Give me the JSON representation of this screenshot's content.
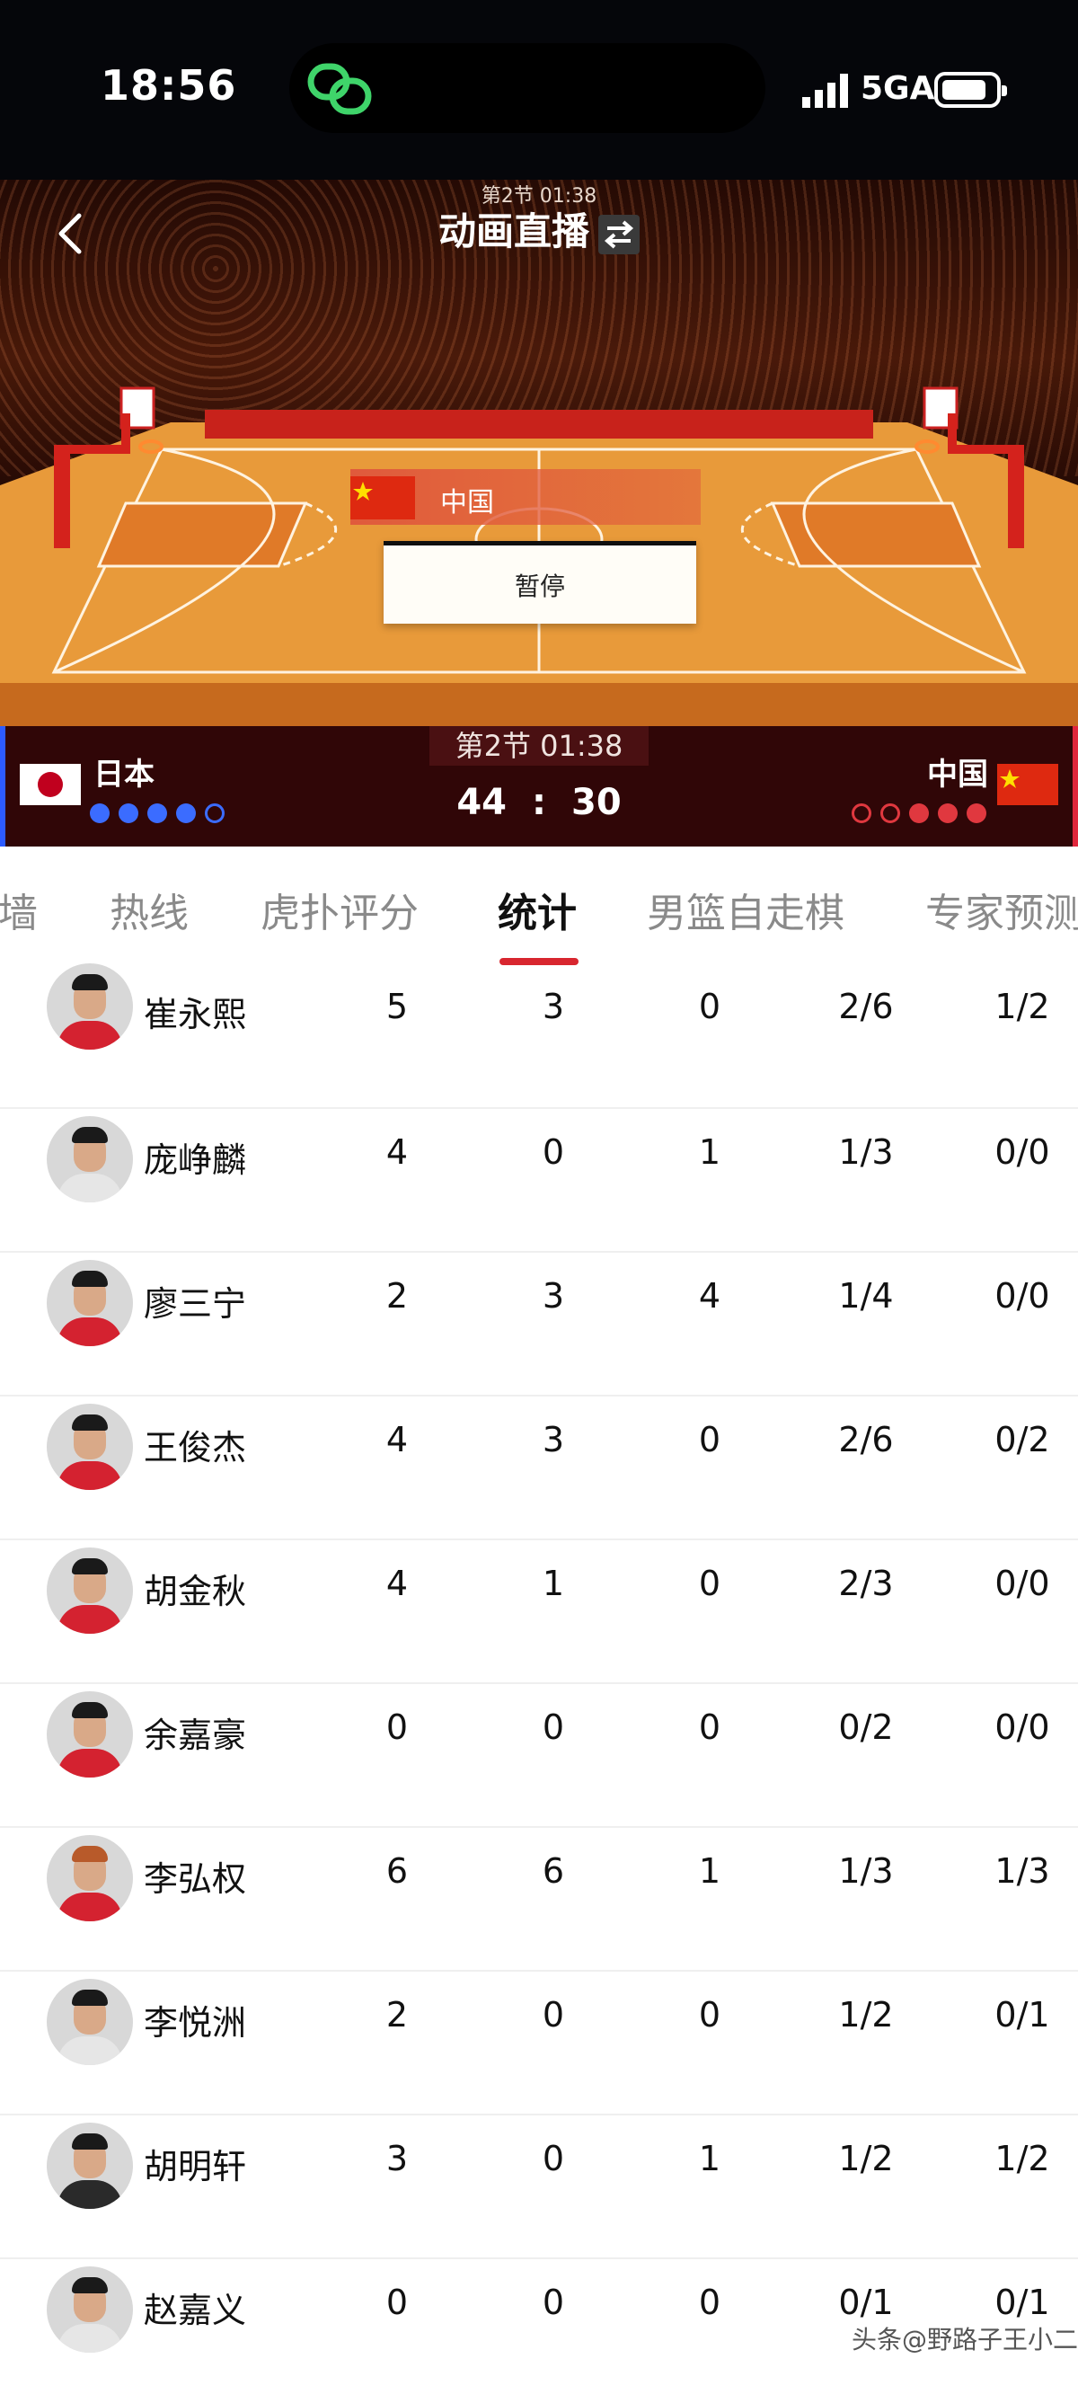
{
  "status_bar": {
    "time": "18:56",
    "network": "5GA"
  },
  "header": {
    "period_small": "第2节 01:38",
    "title": "动画直播",
    "icons": {
      "back": "back-chevron-icon",
      "swap": "swap-arrows-icon"
    }
  },
  "court": {
    "possession_team": "中国",
    "pause_label": "暂停"
  },
  "scoreboard": {
    "period": "第2节 01:38",
    "left_team": "日本",
    "right_team": "中国",
    "left_score": "44",
    "separator": ":",
    "right_score": "30",
    "colors": {
      "left": "#3b6cff",
      "right": "#e0383f",
      "bar": "#300607"
    }
  },
  "tabs": [
    {
      "label": "墙"
    },
    {
      "label": "热线"
    },
    {
      "label": "虎扑评分"
    },
    {
      "label": "统计"
    },
    {
      "label": "男篮自走棋"
    },
    {
      "label": "专家预测"
    }
  ],
  "players": [
    {
      "name": "崔永熙",
      "stats": [
        "5",
        "3",
        "0",
        "2/6",
        "1/2"
      ]
    },
    {
      "name": "庞峥麟",
      "stats": [
        "4",
        "0",
        "1",
        "1/3",
        "0/0"
      ]
    },
    {
      "name": "廖三宁",
      "stats": [
        "2",
        "3",
        "4",
        "1/4",
        "0/0"
      ]
    },
    {
      "name": "王俊杰",
      "stats": [
        "4",
        "3",
        "0",
        "2/6",
        "0/2"
      ]
    },
    {
      "name": "胡金秋",
      "stats": [
        "4",
        "1",
        "0",
        "2/3",
        "0/0"
      ]
    },
    {
      "name": "余嘉豪",
      "stats": [
        "0",
        "0",
        "0",
        "0/2",
        "0/0"
      ]
    },
    {
      "name": "李弘权",
      "stats": [
        "6",
        "6",
        "1",
        "1/3",
        "1/3"
      ]
    },
    {
      "name": "李悦洲",
      "stats": [
        "2",
        "0",
        "0",
        "1/2",
        "0/1"
      ]
    },
    {
      "name": "胡明轩",
      "stats": [
        "3",
        "0",
        "1",
        "1/2",
        "1/2"
      ]
    },
    {
      "name": "赵嘉义",
      "stats": [
        "0",
        "0",
        "0",
        "0/1",
        "0/1"
      ]
    }
  ],
  "watermark": "头条@野路子王小二"
}
